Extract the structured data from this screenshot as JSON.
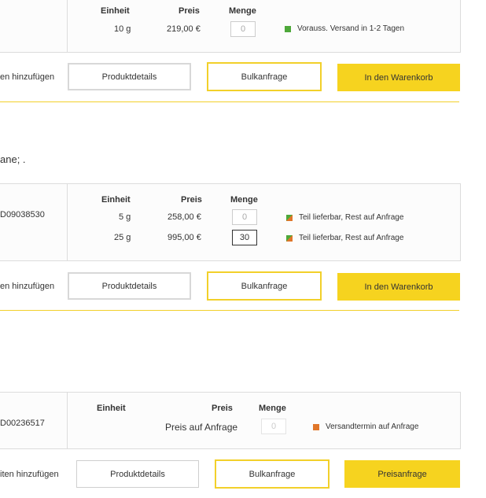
{
  "product1": {
    "headers": {
      "unit": "Einheit",
      "price": "Preis",
      "qty": "Menge"
    },
    "rows": [
      {
        "unit": "10 g",
        "price": "219,00 €",
        "qty": "0",
        "status": "Vorauss. Versand in 1-2 Tagen"
      }
    ],
    "fav_label": "en hinzufügen",
    "buttons": {
      "details": "Produktdetails",
      "bulk": "Bulkanfrage",
      "cart": "In den Warenkorb"
    }
  },
  "fragment_text": "ane; .",
  "product2": {
    "code": "D09038530",
    "headers": {
      "unit": "Einheit",
      "price": "Preis",
      "qty": "Menge"
    },
    "rows": [
      {
        "unit": "5 g",
        "price": "258,00 €",
        "qty": "0",
        "status": "Teil lieferbar, Rest auf Anfrage"
      },
      {
        "unit": "25 g",
        "price": "995,00 €",
        "qty": "30",
        "status": "Teil lieferbar, Rest auf Anfrage"
      }
    ],
    "fav_label": "en hinzufügen",
    "buttons": {
      "details": "Produktdetails",
      "bulk": "Bulkanfrage",
      "cart": "In den Warenkorb"
    }
  },
  "product3": {
    "code": "D00236517",
    "headers": {
      "unit": "Einheit",
      "price": "Preis",
      "qty": "Menge"
    },
    "price_on_request": "Preis auf Anfrage",
    "qty": "0",
    "status": "Versandtermin auf Anfrage",
    "fav_label": "iten hinzufügen",
    "buttons": {
      "details": "Produktdetails",
      "bulk": "Bulkanfrage",
      "price_request": "Preisanfrage"
    }
  },
  "colors": {
    "accent": "#f6d31f",
    "status_green": "#4ea83a",
    "status_orange": "#e0762a"
  }
}
